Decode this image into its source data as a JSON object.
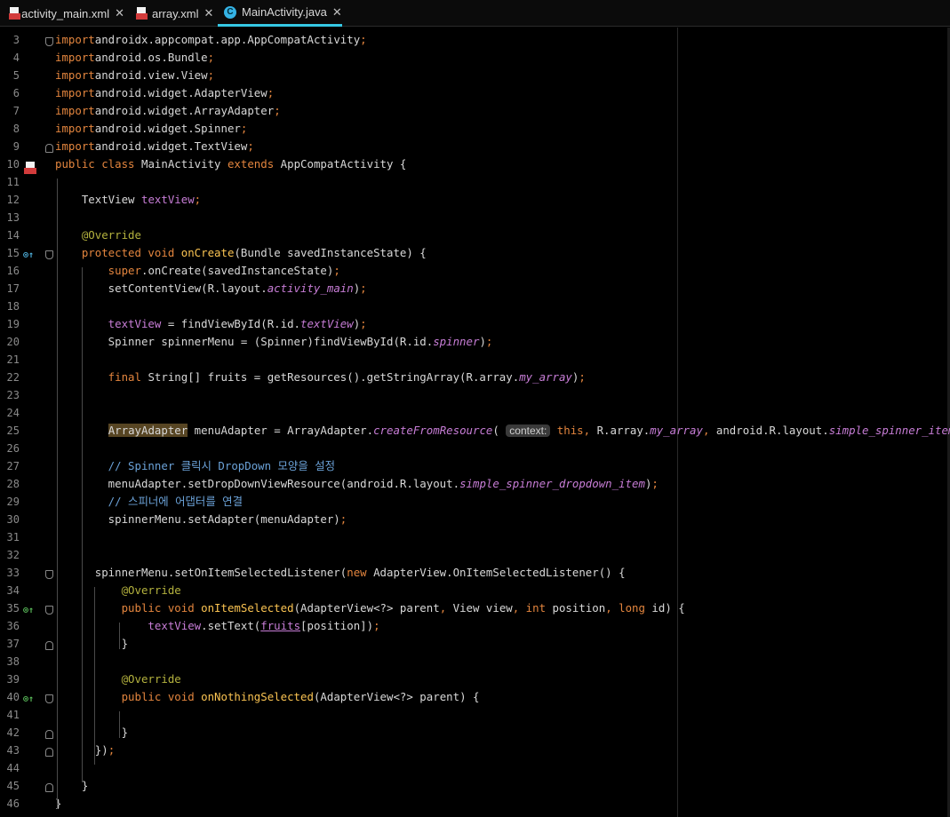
{
  "tabs": [
    {
      "label": "activity_main.xml",
      "type": "xml",
      "active": false
    },
    {
      "label": "array.xml",
      "type": "xml",
      "active": false
    },
    {
      "label": "MainActivity.java",
      "type": "java",
      "active": true
    }
  ],
  "close_glyph": "✕",
  "java_icon_letter": "C",
  "code": {
    "line_numbers": [
      "3",
      "4",
      "5",
      "6",
      "7",
      "8",
      "9",
      "10",
      "11",
      "12",
      "13",
      "14",
      "15",
      "16",
      "17",
      "18",
      "19",
      "20",
      "21",
      "22",
      "23",
      "24",
      "25",
      "26",
      "27",
      "28",
      "29",
      "30",
      "31",
      "32",
      "33",
      "34",
      "35",
      "36",
      "37",
      "38",
      "39",
      "40",
      "41",
      "42",
      "43",
      "44",
      "45",
      "46"
    ],
    "lines": [
      [
        [
          "kw",
          "import"
        ],
        [
          "",
          "androidx.appcompat.app.AppCompatActivity"
        ],
        [
          "kw",
          ";"
        ]
      ],
      [
        [
          "kw",
          "import"
        ],
        [
          "",
          "android.os.Bundle"
        ],
        [
          "kw",
          ";"
        ]
      ],
      [
        [
          "kw",
          "import"
        ],
        [
          "",
          "android.view.View"
        ],
        [
          "kw",
          ";"
        ]
      ],
      [
        [
          "kw",
          "import"
        ],
        [
          "",
          "android.widget.AdapterView"
        ],
        [
          "kw",
          ";"
        ]
      ],
      [
        [
          "kw",
          "import"
        ],
        [
          "",
          "android.widget.ArrayAdapter"
        ],
        [
          "kw",
          ";"
        ]
      ],
      [
        [
          "kw",
          "import"
        ],
        [
          "",
          "android.widget.Spinner"
        ],
        [
          "kw",
          ";"
        ]
      ],
      [
        [
          "kw",
          "import"
        ],
        [
          "",
          "android.widget.TextView"
        ],
        [
          "kw",
          ";"
        ]
      ],
      [
        [
          "kw",
          "public class "
        ],
        [
          "",
          "MainActivity "
        ],
        [
          "kw",
          "extends "
        ],
        [
          "",
          "AppCompatActivity {"
        ]
      ],
      [],
      [
        [
          "",
          "    TextView "
        ],
        [
          "fld",
          "textView"
        ],
        [
          "kw",
          ";"
        ]
      ],
      [],
      [
        [
          "ann",
          "    @Override"
        ]
      ],
      [
        [
          "kw",
          "    protected void "
        ],
        [
          "fn",
          "onCreate"
        ],
        [
          "",
          "(Bundle savedInstanceState) {"
        ]
      ],
      [
        [
          "kw",
          "        super"
        ],
        [
          "",
          ".onCreate(savedInstanceState)"
        ],
        [
          "kw",
          ";"
        ]
      ],
      [
        [
          "",
          "        setContentView(R.layout."
        ],
        [
          "it",
          "activity_main"
        ],
        [
          "",
          ")"
        ],
        [
          "kw",
          ";"
        ]
      ],
      [],
      [
        [
          "fld",
          "        textView"
        ],
        [
          "",
          " = findViewById(R.id."
        ],
        [
          "it",
          "textView"
        ],
        [
          "",
          ")"
        ],
        [
          "kw",
          ";"
        ]
      ],
      [
        [
          "",
          "        Spinner spinnerMenu = (Spinner)findViewById(R.id."
        ],
        [
          "it",
          "spinner"
        ],
        [
          "",
          ")"
        ],
        [
          "kw",
          ";"
        ]
      ],
      [],
      [
        [
          "kw",
          "        final "
        ],
        [
          "",
          "String[] fruits = getResources().getStringArray(R.array."
        ],
        [
          "it",
          "my_array"
        ],
        [
          "",
          ")"
        ],
        [
          "kw",
          ";"
        ]
      ],
      [],
      [],
      [
        [
          "",
          "        "
        ],
        [
          "hl",
          "ArrayAdapter"
        ],
        [
          "",
          " menuAdapter = ArrayAdapter."
        ],
        [
          "it",
          "createFromResource"
        ],
        [
          "",
          "( "
        ],
        [
          "hint",
          "context:"
        ],
        [
          "kw",
          " this"
        ],
        [
          "kw",
          ", "
        ],
        [
          "",
          "R.array."
        ],
        [
          "it",
          "my_array"
        ],
        [
          "kw",
          ", "
        ],
        [
          "",
          "android.R.layout."
        ],
        [
          "it",
          "simple_spinner_item"
        ],
        [
          "",
          ")"
        ],
        [
          "kw",
          ";"
        ]
      ],
      [],
      [
        [
          "cmt",
          "        // Spinner 클릭시 DropDown 모양을 설정"
        ]
      ],
      [
        [
          "",
          "        menuAdapter.setDropDownViewResource(android.R.layout."
        ],
        [
          "it",
          "simple_spinner_dropdown_item"
        ],
        [
          "",
          ")"
        ],
        [
          "kw",
          ";"
        ]
      ],
      [
        [
          "cmt",
          "        // 스피너에 어댑터를 연결"
        ]
      ],
      [
        [
          "",
          "        spinnerMenu.setAdapter(menuAdapter)"
        ],
        [
          "kw",
          ";"
        ]
      ],
      [],
      [],
      [
        [
          "",
          "      spinnerMenu.setOnItemSelectedListener("
        ],
        [
          "kw",
          "new "
        ],
        [
          "",
          "AdapterView.OnItemSelectedListener() {"
        ]
      ],
      [
        [
          "ann",
          "          @Override"
        ]
      ],
      [
        [
          "kw",
          "          public void "
        ],
        [
          "fn",
          "onItemSelected"
        ],
        [
          "",
          "(AdapterView<?> parent"
        ],
        [
          "kw",
          ", "
        ],
        [
          "",
          "View view"
        ],
        [
          "kw",
          ", int "
        ],
        [
          "",
          "position"
        ],
        [
          "kw",
          ", long "
        ],
        [
          "",
          "id) {"
        ]
      ],
      [
        [
          "fld",
          "              textView"
        ],
        [
          "",
          ".setText("
        ],
        [
          "fld ul",
          "fruits"
        ],
        [
          "",
          "[position])"
        ],
        [
          "kw",
          ";"
        ]
      ],
      [
        [
          "",
          "          }"
        ]
      ],
      [],
      [
        [
          "ann",
          "          @Override"
        ]
      ],
      [
        [
          "kw",
          "          public void "
        ],
        [
          "fn",
          "onNothingSelected"
        ],
        [
          "",
          "(AdapterView<?> parent) {"
        ]
      ],
      [],
      [
        [
          "",
          "          }"
        ]
      ],
      [
        [
          "",
          "      })"
        ],
        [
          "kw",
          ";"
        ]
      ],
      [],
      [
        [
          "",
          "    }"
        ]
      ],
      [
        [
          "",
          "}"
        ]
      ]
    ]
  },
  "colors": {
    "keyword": "#e3853e",
    "function": "#fbc452",
    "field": "#c77dd6",
    "annotation": "#b4b23e",
    "comment": "#6ba2d8",
    "active_tab_underline": "#36c9e5"
  }
}
